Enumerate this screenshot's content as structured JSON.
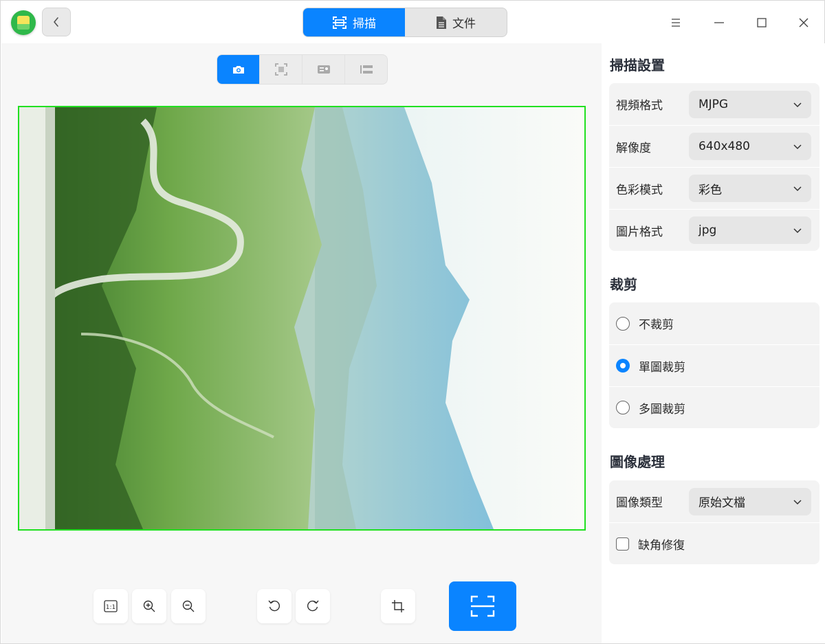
{
  "titlebar": {
    "tabs": [
      {
        "label": "掃描",
        "icon": "scan-icon",
        "active": true
      },
      {
        "label": "文件",
        "icon": "document-icon",
        "active": false
      }
    ]
  },
  "capture_modes": [
    {
      "icon": "camera-icon",
      "active": true
    },
    {
      "icon": "scan-frame-icon",
      "active": false
    },
    {
      "icon": "id-card-icon",
      "active": false
    },
    {
      "icon": "stitch-icon",
      "active": false
    }
  ],
  "bottom_toolbar": {
    "buttons": [
      {
        "icon": "actual-size-icon",
        "label": "1:1"
      },
      {
        "icon": "zoom-in-icon"
      },
      {
        "icon": "zoom-out-icon"
      },
      {
        "icon": "rotate-left-icon"
      },
      {
        "icon": "rotate-right-icon"
      },
      {
        "icon": "crop-icon"
      }
    ],
    "scan_button_icon": "scan-icon"
  },
  "scan_settings": {
    "title": "掃描設置",
    "rows": [
      {
        "label": "視頻格式",
        "value": "MJPG"
      },
      {
        "label": "解像度",
        "value": "640x480"
      },
      {
        "label": "色彩模式",
        "value": "彩色"
      },
      {
        "label": "圖片格式",
        "value": "jpg"
      }
    ]
  },
  "crop": {
    "title": "裁剪",
    "options": [
      {
        "label": "不裁剪",
        "checked": false
      },
      {
        "label": "單圖裁剪",
        "checked": true
      },
      {
        "label": "多圖裁剪",
        "checked": false
      }
    ]
  },
  "image_processing": {
    "title": "圖像處理",
    "type_label": "圖像類型",
    "type_value": "原始文檔",
    "repair_label": "缺角修復",
    "repair_checked": false
  },
  "colors": {
    "accent": "#0a84ff",
    "crop_frame": "#20e020"
  }
}
